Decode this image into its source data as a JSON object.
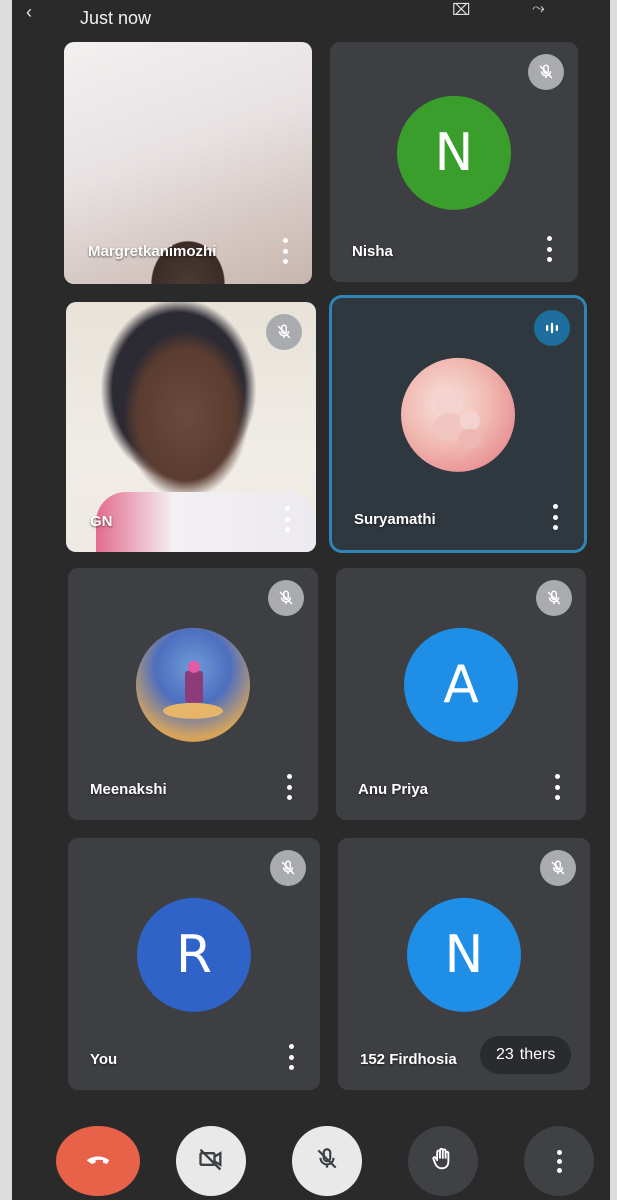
{
  "status": {
    "time_label": "Just now"
  },
  "participants": [
    {
      "name": "Margretkanimozhi",
      "type": "video"
    },
    {
      "name": "Nisha",
      "type": "initial",
      "initial": "N",
      "color": "#3a9e2c",
      "muted": true
    },
    {
      "name": "GN",
      "type": "video",
      "muted": true
    },
    {
      "name": "Suryamathi",
      "type": "avatar-image",
      "speaking": true
    },
    {
      "name": "Meenakshi",
      "type": "avatar-image",
      "muted": true
    },
    {
      "name": "Anu Priya",
      "type": "initial",
      "initial": "A",
      "color": "#1e8ee6",
      "muted": true
    },
    {
      "name": "You",
      "type": "initial",
      "initial": "R",
      "color": "#2f63c8",
      "muted": true
    },
    {
      "name": "152 Firdhosia",
      "type": "initial",
      "initial": "N",
      "color": "#1e8ee6",
      "muted": true
    }
  ],
  "others_chip": {
    "count": "23",
    "label": "thers"
  },
  "controls": {
    "end_call": "end-call-icon",
    "camera": "camera-off-icon",
    "mic": "mic-off-icon",
    "hand": "raise-hand-icon",
    "more": "more-vert-icon"
  },
  "colors": {
    "end_call": "#e8624a",
    "speaking_border": "#2f86b6"
  }
}
